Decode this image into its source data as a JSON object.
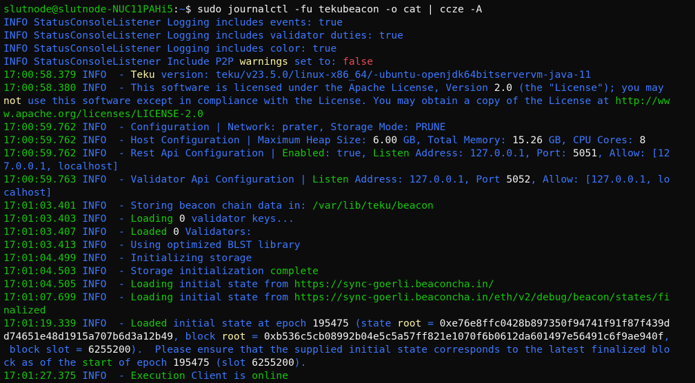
{
  "terminal": {
    "colors": {
      "background": "#0c0c0c",
      "default": "#cccccc",
      "green": "#16c60c",
      "blue": "#3b78ff",
      "red": "#e74856",
      "yellow": "#f9f1a5",
      "white": "#f2f2f2"
    },
    "lines": [
      [
        {
          "t": "slutnode@slutnode-NUC11PAHi5",
          "c": "green"
        },
        {
          "t": ":",
          "c": "white"
        },
        {
          "t": "~",
          "c": "blue"
        },
        {
          "t": "$ sudo journalctl -fu tekubeacon -o cat | ccze -A",
          "c": "white"
        }
      ],
      [
        {
          "t": "INFO StatusConsoleListener Logging includes events: true",
          "c": "blue"
        }
      ],
      [
        {
          "t": "INFO StatusConsoleListener Logging includes validator duties: true",
          "c": "blue"
        }
      ],
      [
        {
          "t": "INFO StatusConsoleListener Logging includes color: true",
          "c": "blue"
        }
      ],
      [
        {
          "t": "INFO StatusConsoleListener Include P2P ",
          "c": "blue"
        },
        {
          "t": "warnings",
          "c": "yellow"
        },
        {
          "t": " set to: ",
          "c": "blue"
        },
        {
          "t": "false",
          "c": "red"
        }
      ],
      [
        {
          "t": "17:00:58.379 ",
          "c": "green"
        },
        {
          "t": "INFO",
          "c": "blue"
        },
        {
          "t": "  - ",
          "c": "blue"
        },
        {
          "t": "Teku",
          "c": "yellow"
        },
        {
          "t": " version: teku/v23.5.0/linux-x86_64/-ubuntu-openjdk64bitservervm-java-11",
          "c": "blue"
        }
      ],
      [
        {
          "t": "17:00:58.380 ",
          "c": "green"
        },
        {
          "t": "INFO",
          "c": "blue"
        },
        {
          "t": "  - This software is licensed under the Apache License, Version ",
          "c": "blue"
        },
        {
          "t": "2.0",
          "c": "white"
        },
        {
          "t": " (the \"License\"); you may",
          "c": "blue"
        }
      ],
      [
        {
          "t": "not",
          "c": "yellow"
        },
        {
          "t": " use this software except in compliance with the License. You may obtain a copy of the License at ",
          "c": "blue"
        },
        {
          "t": "http://ww",
          "c": "green"
        }
      ],
      [
        {
          "t": "w.apache.org/licenses/LICENSE-2.0",
          "c": "green"
        }
      ],
      [
        {
          "t": "17:00:59.762 ",
          "c": "green"
        },
        {
          "t": "INFO",
          "c": "blue"
        },
        {
          "t": "  - Configuration | Network: prater, Storage Mode: PRUNE",
          "c": "blue"
        }
      ],
      [
        {
          "t": "17:00:59.762 ",
          "c": "green"
        },
        {
          "t": "INFO",
          "c": "blue"
        },
        {
          "t": "  - Host Configuration | Maximum Heap Size: ",
          "c": "blue"
        },
        {
          "t": "6.00",
          "c": "white"
        },
        {
          "t": " GB, Total Memory: ",
          "c": "blue"
        },
        {
          "t": "15.26",
          "c": "white"
        },
        {
          "t": " GB, CPU Cores: ",
          "c": "blue"
        },
        {
          "t": "8",
          "c": "white"
        }
      ],
      [
        {
          "t": "17:00:59.762 ",
          "c": "green"
        },
        {
          "t": "INFO",
          "c": "blue"
        },
        {
          "t": "  - Rest Api Configuration | ",
          "c": "blue"
        },
        {
          "t": "Enabled",
          "c": "green"
        },
        {
          "t": ": true, ",
          "c": "blue"
        },
        {
          "t": "Listen",
          "c": "green"
        },
        {
          "t": " Address: ",
          "c": "blue"
        },
        {
          "t": "127.0.0.1",
          "c": "blue"
        },
        {
          "t": ", Port: ",
          "c": "blue"
        },
        {
          "t": "5051",
          "c": "white"
        },
        {
          "t": ", Allow: [12",
          "c": "blue"
        }
      ],
      [
        {
          "t": "7.0.0.1, localhost]",
          "c": "blue"
        }
      ],
      [
        {
          "t": "17:00:59.763 ",
          "c": "green"
        },
        {
          "t": "INFO",
          "c": "blue"
        },
        {
          "t": "  - Validator Api Configuration | ",
          "c": "blue"
        },
        {
          "t": "Listen",
          "c": "green"
        },
        {
          "t": " Address: ",
          "c": "blue"
        },
        {
          "t": "127.0.0.1",
          "c": "blue"
        },
        {
          "t": ", Port ",
          "c": "blue"
        },
        {
          "t": "5052",
          "c": "white"
        },
        {
          "t": ", Allow: [127.0.0.1, lo",
          "c": "blue"
        }
      ],
      [
        {
          "t": "calhost]",
          "c": "blue"
        }
      ],
      [
        {
          "t": "17:01:03.401 ",
          "c": "green"
        },
        {
          "t": "INFO",
          "c": "blue"
        },
        {
          "t": "  - Storing beacon chain data in: ",
          "c": "blue"
        },
        {
          "t": "/var/lib/teku/beacon",
          "c": "green"
        }
      ],
      [
        {
          "t": "17:01:03.403 ",
          "c": "green"
        },
        {
          "t": "INFO",
          "c": "blue"
        },
        {
          "t": "  - ",
          "c": "blue"
        },
        {
          "t": "Loading",
          "c": "green"
        },
        {
          "t": " ",
          "c": "blue"
        },
        {
          "t": "0",
          "c": "white"
        },
        {
          "t": " validator keys...",
          "c": "blue"
        }
      ],
      [
        {
          "t": "17:01:03.407 ",
          "c": "green"
        },
        {
          "t": "INFO",
          "c": "blue"
        },
        {
          "t": "  - ",
          "c": "blue"
        },
        {
          "t": "Loaded",
          "c": "green"
        },
        {
          "t": " ",
          "c": "blue"
        },
        {
          "t": "0",
          "c": "white"
        },
        {
          "t": " Validators:",
          "c": "blue"
        }
      ],
      [
        {
          "t": "17:01:03.413 ",
          "c": "green"
        },
        {
          "t": "INFO",
          "c": "blue"
        },
        {
          "t": "  - Using optimized BLST library",
          "c": "blue"
        }
      ],
      [
        {
          "t": "17:01:04.499 ",
          "c": "green"
        },
        {
          "t": "INFO",
          "c": "blue"
        },
        {
          "t": "  - Initializing storage",
          "c": "blue"
        }
      ],
      [
        {
          "t": "17:01:04.503 ",
          "c": "green"
        },
        {
          "t": "INFO",
          "c": "blue"
        },
        {
          "t": "  - Storage initialization ",
          "c": "blue"
        },
        {
          "t": "complete",
          "c": "green"
        }
      ],
      [
        {
          "t": "17:01:04.505 ",
          "c": "green"
        },
        {
          "t": "INFO",
          "c": "blue"
        },
        {
          "t": "  - ",
          "c": "blue"
        },
        {
          "t": "Loading",
          "c": "green"
        },
        {
          "t": " initial state from ",
          "c": "blue"
        },
        {
          "t": "https://sync-goerli.beaconcha.in/",
          "c": "green"
        }
      ],
      [
        {
          "t": "17:01:07.699 ",
          "c": "green"
        },
        {
          "t": "INFO",
          "c": "blue"
        },
        {
          "t": "  - ",
          "c": "blue"
        },
        {
          "t": "Loading",
          "c": "green"
        },
        {
          "t": " initial state from ",
          "c": "blue"
        },
        {
          "t": "https://sync-goerli.beaconcha.in/eth/v2/debug/beacon/states/fi",
          "c": "green"
        }
      ],
      [
        {
          "t": "nalized",
          "c": "green"
        }
      ],
      [
        {
          "t": "17:01:19.339 ",
          "c": "green"
        },
        {
          "t": "INFO",
          "c": "blue"
        },
        {
          "t": "  - ",
          "c": "blue"
        },
        {
          "t": "Loaded",
          "c": "green"
        },
        {
          "t": " initial state at epoch ",
          "c": "blue"
        },
        {
          "t": "195475",
          "c": "white"
        },
        {
          "t": " (state ",
          "c": "blue"
        },
        {
          "t": "root",
          "c": "yellow"
        },
        {
          "t": " = ",
          "c": "blue"
        },
        {
          "t": "0xe76e8ffc0428b897350f94741f91f87f439d",
          "c": "white"
        }
      ],
      [
        {
          "t": "d74651e48d1915a707b6d3a12b49",
          "c": "white"
        },
        {
          "t": ", block ",
          "c": "blue"
        },
        {
          "t": "root",
          "c": "yellow"
        },
        {
          "t": " = ",
          "c": "blue"
        },
        {
          "t": "0xb536c5cb08992b04e5c5a57ff821e1070f6b0612da601497e56491c6f9ae940f",
          "c": "white"
        },
        {
          "t": ",",
          "c": "blue"
        }
      ],
      [
        {
          "t": " block slot = ",
          "c": "blue"
        },
        {
          "t": "6255200",
          "c": "white"
        },
        {
          "t": ").  Please ensure that the supplied initial state corresponds to the latest finalized blo",
          "c": "blue"
        }
      ],
      [
        {
          "t": "ck as of the ",
          "c": "blue"
        },
        {
          "t": "start",
          "c": "green"
        },
        {
          "t": " of epoch ",
          "c": "blue"
        },
        {
          "t": "195475",
          "c": "white"
        },
        {
          "t": " (slot ",
          "c": "blue"
        },
        {
          "t": "6255200",
          "c": "white"
        },
        {
          "t": ").",
          "c": "blue"
        }
      ],
      [
        {
          "t": "17:01:27.375 ",
          "c": "green"
        },
        {
          "t": "INFO",
          "c": "blue"
        },
        {
          "t": "  - ",
          "c": "blue"
        },
        {
          "t": "Execution",
          "c": "green"
        },
        {
          "t": " Client is ",
          "c": "blue"
        },
        {
          "t": "online",
          "c": "green"
        }
      ]
    ]
  }
}
